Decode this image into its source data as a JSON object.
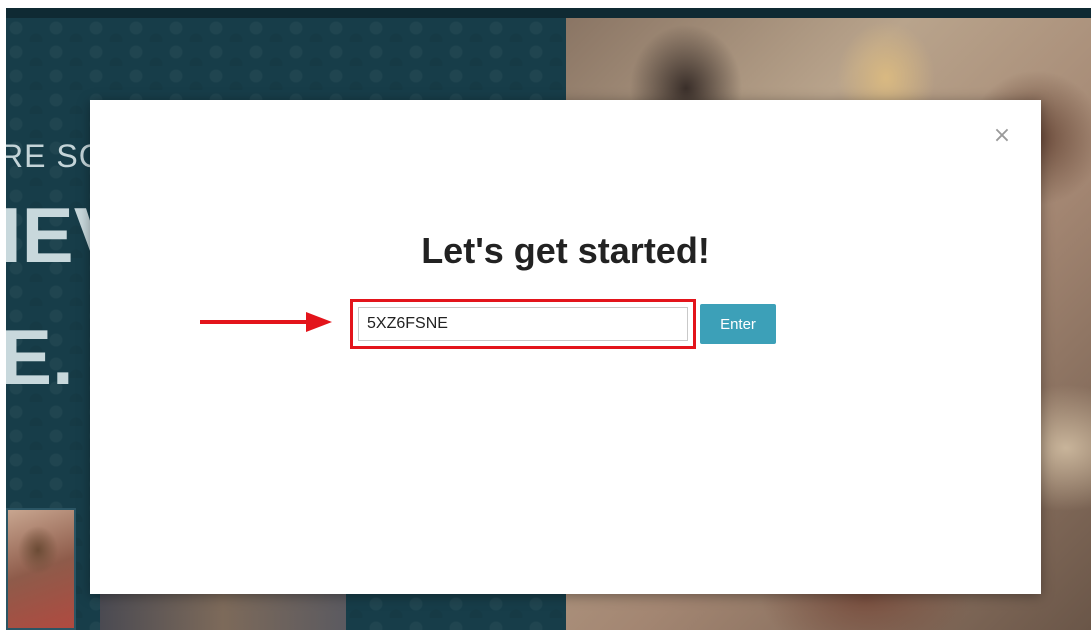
{
  "hero": {
    "eyebrow": "RE SC",
    "line1": "IEV",
    "line2": "E."
  },
  "modal": {
    "close_icon": "close-icon",
    "close_glyph": "×",
    "title": "Let's get started!",
    "code_input_value": "5XZ6FSNE",
    "enter_label": "Enter"
  },
  "colors": {
    "hero_background": "#173d49",
    "enter_button": "#3ca0b8",
    "annotation_red": "#e3141b"
  }
}
